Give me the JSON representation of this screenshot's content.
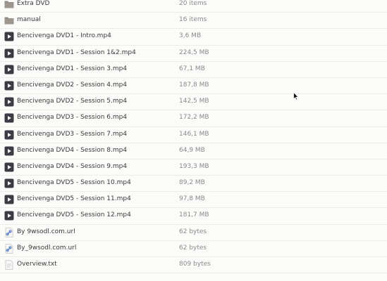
{
  "files": [
    {
      "icon": "folder-icon",
      "name": "Extra DVD",
      "size": "20 items"
    },
    {
      "icon": "folder-icon",
      "name": "manual",
      "size": "16 items"
    },
    {
      "icon": "video-file-icon",
      "name": "Bencivenga DVD1 - Intro.mp4",
      "size": "3,6 MB"
    },
    {
      "icon": "video-file-icon",
      "name": "Bencivenga DVD1 - Session 1&2.mp4",
      "size": "224,5 MB"
    },
    {
      "icon": "video-file-icon",
      "name": "Bencivenga DVD1 - Session 3.mp4",
      "size": "67,1 MB"
    },
    {
      "icon": "video-file-icon",
      "name": "Bencivenga DVD2 - Session 4.mp4",
      "size": "187,8 MB"
    },
    {
      "icon": "video-file-icon",
      "name": "Bencivenga DVD2 - Session 5.mp4",
      "size": "142,5 MB"
    },
    {
      "icon": "video-file-icon",
      "name": "Bencivenga DVD3 - Session 6.mp4",
      "size": "172,2 MB"
    },
    {
      "icon": "video-file-icon",
      "name": "Bencivenga DVD3 - Session 7.mp4",
      "size": "146,1 MB"
    },
    {
      "icon": "video-file-icon",
      "name": "Bencivenga DVD4 - Session 8.mp4",
      "size": "64,9 MB"
    },
    {
      "icon": "video-file-icon",
      "name": "Bencivenga DVD4 - Session 9.mp4",
      "size": "193,3 MB"
    },
    {
      "icon": "video-file-icon",
      "name": "Bencivenga DVD5 - Session 10.mp4",
      "size": "89,2 MB"
    },
    {
      "icon": "video-file-icon",
      "name": "Bencivenga DVD5 - Session 11.mp4",
      "size": "97,8 MB"
    },
    {
      "icon": "video-file-icon",
      "name": "Bencivenga DVD5 - Session 12.mp4",
      "size": "181,7 MB"
    },
    {
      "icon": "link-file-icon",
      "name": "By 9wsodl.com.url",
      "size": "62 bytes"
    },
    {
      "icon": "link-file-icon",
      "name": "By_9wsodl.com.url",
      "size": "62 bytes"
    },
    {
      "icon": "text-file-icon",
      "name": "Overview.txt",
      "size": "809 bytes"
    }
  ],
  "colors": {
    "folder": "#8f877f",
    "video": "#3d3a44",
    "link": "#5a7fc0"
  }
}
